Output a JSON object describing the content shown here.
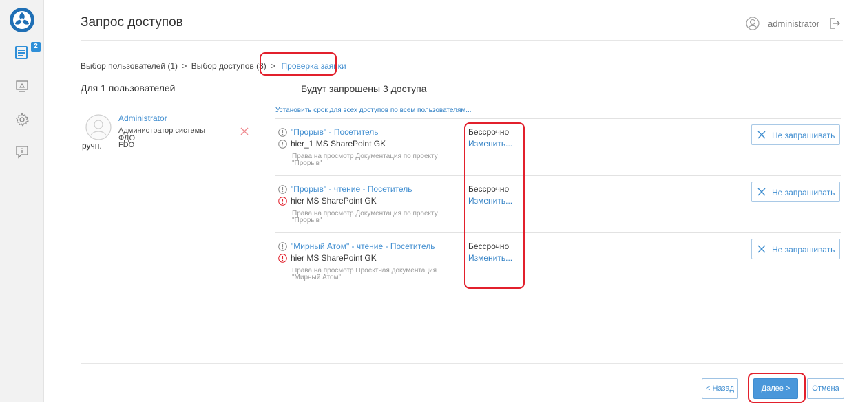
{
  "header": {
    "title": "Запрос доступов",
    "username": "administrator"
  },
  "sidebar": {
    "badge_count": "2"
  },
  "breadcrumb": {
    "step1": "Выбор пользователей (1)",
    "step2": "Выбор доступов (3)",
    "separator": ">",
    "step3": "Проверка заявки"
  },
  "left": {
    "title": "Для 1 пользователей",
    "user": {
      "name": "Administrator",
      "role": "Администратор системы",
      "org1": "ФДО",
      "org2": "FDO",
      "mode": "ручн."
    }
  },
  "right": {
    "title": "Будут запрошены 3 доступа",
    "set_all_link": "Установить срок для всех доступов по всем пользователям...",
    "no_request_label": "Не запрашивать",
    "rows": [
      {
        "access": "\"Прорыв\" - Посетитель",
        "system": "hier_1 MS SharePoint GK",
        "desc1": "Права на просмотр Документация по проекту",
        "desc2": "\"Прорыв\"",
        "term": "Бессрочно",
        "change": "Изменить...",
        "system_icon_color": "#888888"
      },
      {
        "access": "\"Прорыв\" - чтение - Посетитель",
        "system": "hier MS SharePoint GK",
        "desc1": "Права на просмотр Документация по проекту",
        "desc2": "\"Прорыв\"",
        "term": "Бессрочно",
        "change": "Изменить...",
        "system_icon_color": "#e2202c"
      },
      {
        "access": "\"Мирный Атом\" - чтение - Посетитель",
        "system": "hier MS SharePoint GK",
        "desc1": "Права на просмотр Проектная документация",
        "desc2": "\"Мирный Атом\"",
        "term": "Бессрочно",
        "change": "Изменить...",
        "system_icon_color": "#e2202c"
      }
    ]
  },
  "footer": {
    "back": "< Назад",
    "next": "Далее >",
    "cancel": "Отмена"
  },
  "colors": {
    "accent": "#3f8dd0",
    "highlight": "#e2202c"
  }
}
